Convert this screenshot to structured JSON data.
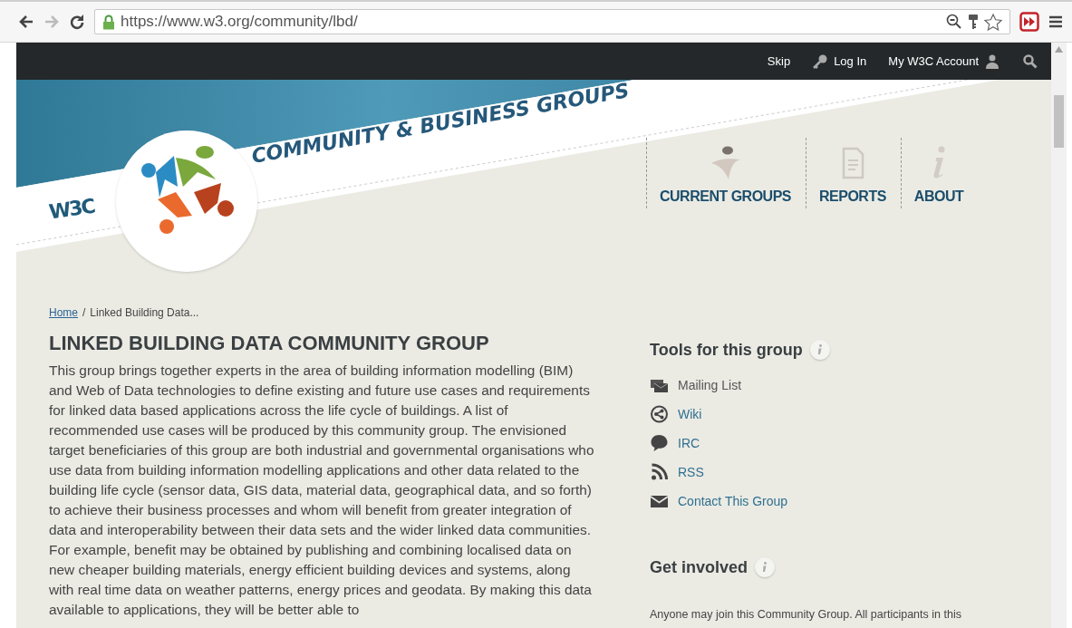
{
  "browser": {
    "url": "https://www.w3.org/community/lbd/"
  },
  "top_bar": {
    "skip": "Skip",
    "login": "Log In",
    "account": "My W3C Account"
  },
  "banner": {
    "logo": "W3C",
    "title": "COMMUNITY & BUSINESS GROUPS"
  },
  "nav": [
    {
      "label": "CURRENT GROUPS",
      "kind": "groups"
    },
    {
      "label": "REPORTS",
      "kind": "reports"
    },
    {
      "label": "ABOUT",
      "kind": "about"
    }
  ],
  "breadcrumb": {
    "home": "Home",
    "separator": "/",
    "current": "Linked Building Data..."
  },
  "title": "LINKED BUILDING DATA COMMUNITY GROUP",
  "description": "This group brings together experts in the area of building information modelling (BIM) and Web of Data technologies to define existing and future use cases and requirements for linked data based applications across the life cycle of buildings. A list of recommended use cases will be produced by this community group. The envisioned target beneficiaries of this group are both industrial and governmental organisations who use data from building information modelling applications and other data related to the building life cycle (sensor data, GIS data, material data, geographical data, and so forth) to achieve their business processes and whom will benefit from greater integration of data and interoperability between their data sets and the wider linked data communities. For example, benefit may be obtained by publishing and combining localised data on new cheaper building materials, energy efficient building devices and systems, along with real time data on weather patterns, energy prices and geodata. By making this data available to applications, they will be better able to",
  "tools": {
    "heading": "Tools for this group",
    "items": [
      {
        "label": "Mailing List",
        "kind": "mailing",
        "link": false
      },
      {
        "label": "Wiki",
        "kind": "wiki",
        "link": true
      },
      {
        "label": "IRC",
        "kind": "irc",
        "link": true
      },
      {
        "label": "RSS",
        "kind": "rss",
        "link": true
      },
      {
        "label": "Contact This Group",
        "kind": "contact",
        "link": true
      }
    ]
  },
  "involved": {
    "heading": "Get involved",
    "text": "Anyone may join this Community Group. All participants in this"
  }
}
